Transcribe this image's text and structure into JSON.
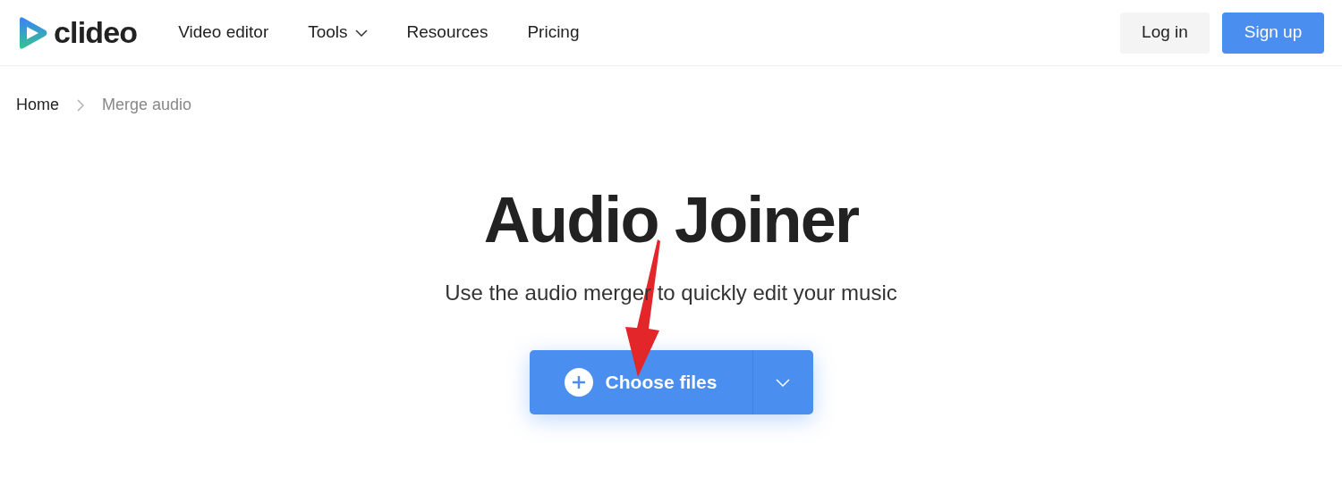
{
  "logo": {
    "text": "clideo"
  },
  "nav": [
    {
      "label": "Video editor",
      "kind": "link"
    },
    {
      "label": "Tools",
      "kind": "dropdown"
    },
    {
      "label": "Resources",
      "kind": "link"
    },
    {
      "label": "Pricing",
      "kind": "link"
    }
  ],
  "auth": {
    "login": "Log in",
    "signup": "Sign up"
  },
  "breadcrumb": [
    {
      "label": "Home",
      "current": false
    },
    {
      "label": "Merge audio",
      "current": true
    }
  ],
  "title": "Audio Joiner",
  "subtitle": "Use the audio merger to quickly edit your music",
  "upload_button": {
    "label": "Choose files"
  }
}
